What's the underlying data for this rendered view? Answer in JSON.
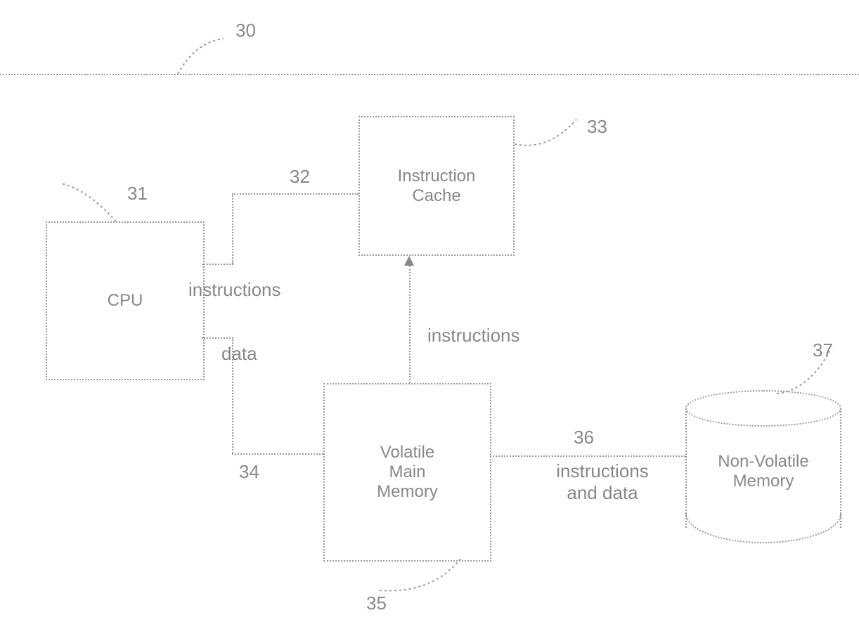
{
  "diagram": {
    "boundary_ref": "30",
    "cpu": {
      "label": "CPU",
      "ref": "31"
    },
    "icache": {
      "label": "Instruction\nCache",
      "ref": "33"
    },
    "vmm": {
      "label": "Volatile\nMain\nMemory",
      "ref": "35"
    },
    "nvm": {
      "label": "Non-Volatile\nMemory",
      "ref": "37"
    },
    "edges": {
      "cpu_icache": {
        "ref": "32",
        "label": "instructions"
      },
      "cpu_vmm": {
        "ref": "34",
        "label": "data"
      },
      "vmm_icache": {
        "label": "instructions"
      },
      "vmm_nvm": {
        "ref": "36",
        "label": "instructions\nand data"
      }
    }
  }
}
